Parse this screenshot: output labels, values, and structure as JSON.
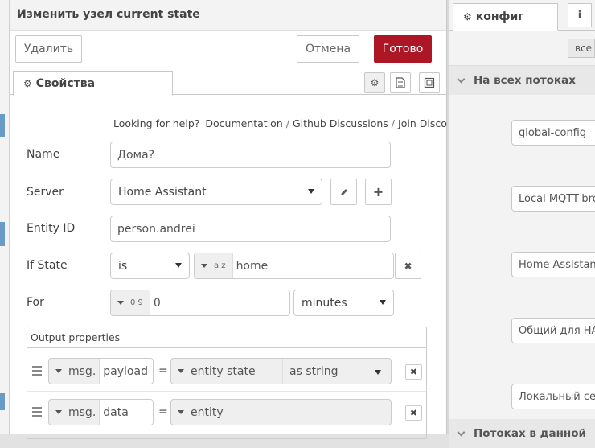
{
  "dialog": {
    "title": "Изменить узел current state",
    "delete_label": "Удалить",
    "cancel_label": "Отмена",
    "done_label": "Готово",
    "tab_label": "Свойства"
  },
  "help": {
    "prompt": "Looking for help?",
    "links": [
      "Documentation",
      "Github Discussions",
      "Join Discord"
    ],
    "separator": "/"
  },
  "form": {
    "name_label": "Name",
    "name_value": "Дома?",
    "server_label": "Server",
    "server_value": "Home Assistant",
    "entity_label": "Entity ID",
    "entity_value": "person.andrei",
    "ifstate_label": "If State",
    "ifstate_operator": "is",
    "ifstate_type_glyph": "a z",
    "ifstate_value": "home",
    "for_label": "For",
    "for_type_glyph": "0 9",
    "for_value": "0",
    "for_unit": "minutes"
  },
  "output": {
    "title": "Output properties",
    "rows": [
      {
        "target_type": "msg.",
        "target": "payload",
        "eq": "=",
        "source": "entity state",
        "source_format": "as string"
      },
      {
        "target_type": "msg.",
        "target": "data",
        "eq": "=",
        "source": "entity"
      }
    ]
  },
  "sidebar": {
    "tab_label": "конфиг",
    "info_label": "i",
    "filter_label": "все",
    "section_all_flows": "На всех потоках",
    "section_this_flow": "Потоках в данной",
    "nodes": [
      "global-config",
      "Local MQTT-brok",
      "Home Assistant",
      "Общий для НА Т",
      "Локальный серв"
    ]
  },
  "colors": {
    "primary_button": "#ad1625",
    "title_accent": "#cc3333"
  }
}
